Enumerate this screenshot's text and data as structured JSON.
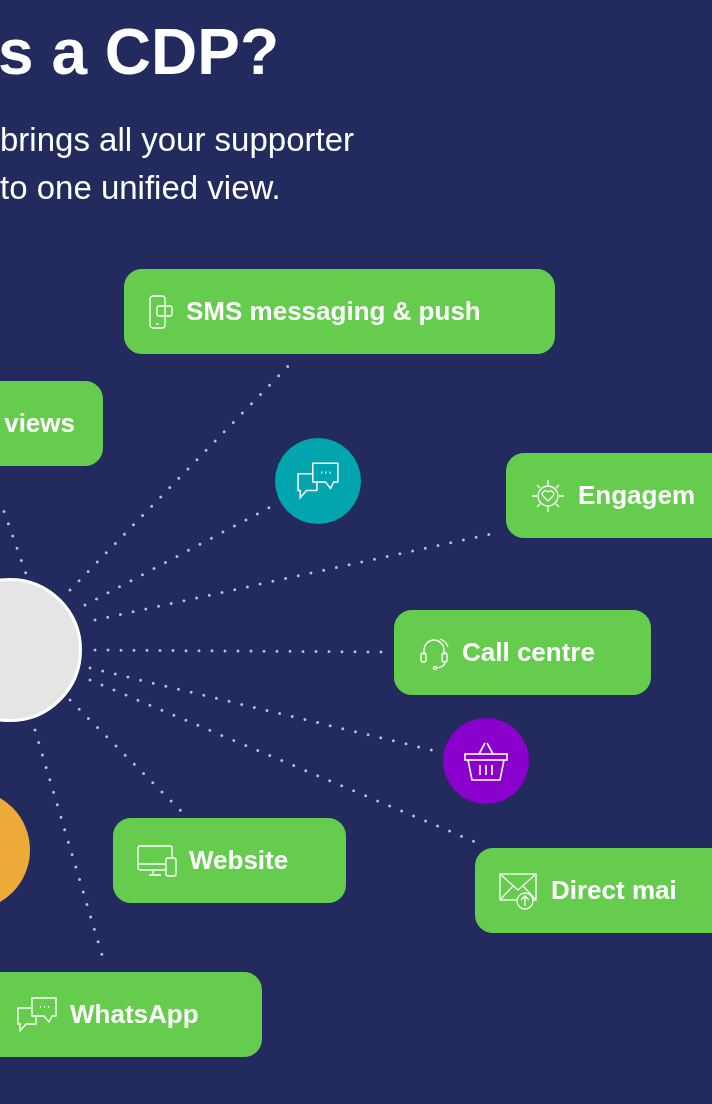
{
  "heading": "s a CDP?",
  "subtitle_lines": [
    "brings all your supporter",
    "to one unified view."
  ],
  "channels": [
    {
      "label": "SMS messaging & push"
    },
    {
      "label": "views"
    },
    {
      "label": "Engagem"
    },
    {
      "label": "Call centre"
    },
    {
      "label": "Website"
    },
    {
      "label": "Direct mai"
    },
    {
      "label": "WhatsApp"
    }
  ],
  "hubs": [
    {
      "color": "#00a5ad"
    },
    {
      "color": "#8a00cc"
    },
    {
      "color": "#eeaa38"
    }
  ]
}
